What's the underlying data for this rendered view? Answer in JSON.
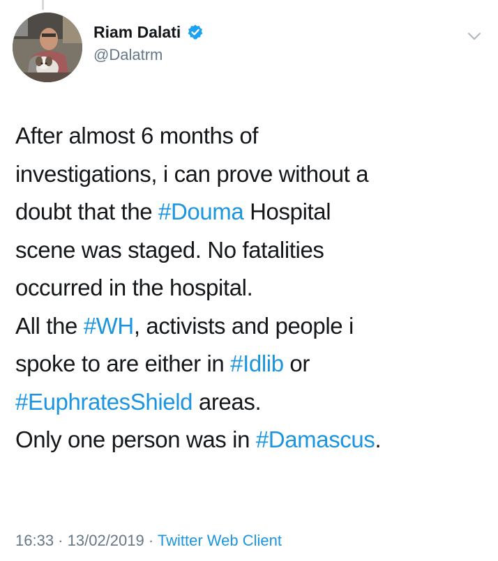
{
  "author": {
    "display_name": "Riam Dalati",
    "handle": "@Dalatrm",
    "verified": true,
    "avatar_icon": "profile-photo-man-with-dog"
  },
  "menu": {
    "icon": "chevron-down-icon"
  },
  "tweet": {
    "segments": {
      "l1": "After almost 6 months of",
      "l2": "investigations, i can prove without a",
      "l3a": "doubt that the ",
      "l3_tag": "#Douma",
      "l3b": " Hospital",
      "l4": "scene was staged. No fatalities",
      "l5": "occurred in the hospital.",
      "l6a": "All the ",
      "l6_tag": "#WH",
      "l6b": ", activists and people i",
      "l7a": "spoke to are either in ",
      "l7_tag": "#Idlib",
      "l7b": " or",
      "l8_tag": "#EuphratesShield",
      "l8b": " areas.",
      "l9a": "Only one person was in ",
      "l9_tag": "#Damascus",
      "l9b": "."
    }
  },
  "meta": {
    "time": "16:33",
    "sep1": " · ",
    "date": "13/02/2019",
    "sep2": " · ",
    "source": "Twitter Web Client"
  },
  "colors": {
    "text": "#14171a",
    "secondary": "#657786",
    "link": "#1b95e0",
    "verified": "#1da1f2"
  }
}
